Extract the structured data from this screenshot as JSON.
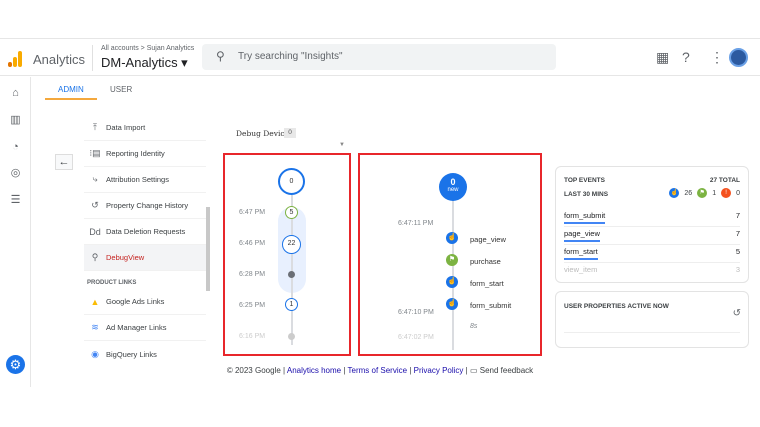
{
  "header": {
    "app_name": "Analytics",
    "breadcrumb": "All accounts > Sujan Analytics",
    "property": "DM-Analytics ▾",
    "search_placeholder": "Try searching \"Insights\""
  },
  "tabs": [
    {
      "label": "ADMIN"
    },
    {
      "label": "USER"
    }
  ],
  "menu": {
    "items": [
      {
        "label": "Data Import",
        "icon": "⤒"
      },
      {
        "label": "Reporting Identity",
        "icon": "⁝▤"
      },
      {
        "label": "Attribution Settings",
        "icon": "⤷"
      },
      {
        "label": "Property Change History",
        "icon": "↺"
      },
      {
        "label": "Data Deletion Requests",
        "icon": "Dd"
      },
      {
        "label": "DebugView",
        "icon": "⚲"
      }
    ],
    "section": "PRODUCT LINKS",
    "links": [
      {
        "label": "Google Ads Links",
        "icon": "▲"
      },
      {
        "label": "Ad Manager Links",
        "icon": "≋"
      },
      {
        "label": "BigQuery Links",
        "icon": "◉"
      }
    ]
  },
  "debug": {
    "label": "Debug Device",
    "count": "0"
  },
  "minutes": {
    "top": "0",
    "rows": [
      {
        "time": "6:47 PM",
        "count": "5"
      },
      {
        "time": "6:46 PM",
        "count": "22"
      },
      {
        "time": "6:28 PM",
        "count": ""
      },
      {
        "time": "6:25 PM",
        "count": "1"
      },
      {
        "time": "6:16 PM",
        "count": ""
      }
    ]
  },
  "seconds": {
    "count": "0",
    "new_label": "new",
    "times": [
      "6:47:11 PM",
      "6:47:10 PM",
      "6:47:02 PM"
    ],
    "gap": "8s",
    "events": [
      {
        "name": "page_view",
        "color": "#1a73e8",
        "icon": "☝"
      },
      {
        "name": "purchase",
        "color": "#7cb342",
        "icon": "⚑"
      },
      {
        "name": "form_start",
        "color": "#1a73e8",
        "icon": "☝"
      },
      {
        "name": "form_submit",
        "color": "#1a73e8",
        "icon": "☝"
      }
    ]
  },
  "top_events": {
    "title": "TOP EVENTS",
    "total": "27 TOTAL",
    "period": "LAST 30 MINS",
    "counts": [
      "26",
      "1",
      "0"
    ],
    "rows": [
      {
        "name": "form_submit",
        "count": "7"
      },
      {
        "name": "page_view",
        "count": "7"
      },
      {
        "name": "form_start",
        "count": "5"
      },
      {
        "name": "view_item",
        "count": "3"
      }
    ]
  },
  "user_props": {
    "title": "USER PROPERTIES ACTIVE NOW"
  },
  "footer": {
    "copy": "© 2023 Google |",
    "home": "Analytics home",
    "sep1": "|",
    "terms": "Terms of Service",
    "sep2": "|",
    "privacy": "Privacy Policy",
    "sep3": "|",
    "feedback": "Send feedback"
  }
}
